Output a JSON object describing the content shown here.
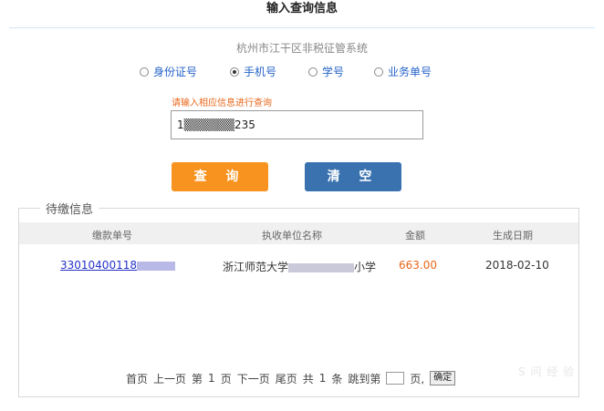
{
  "header": {
    "title": "输入查询信息"
  },
  "system_name": "杭州市江干区非税征管系统",
  "search_type": {
    "options": [
      {
        "label": "身份证号",
        "selected": false
      },
      {
        "label": "手机号",
        "selected": true
      },
      {
        "label": "学号",
        "selected": false
      },
      {
        "label": "业务单号",
        "selected": false
      }
    ]
  },
  "query": {
    "hint": "请输入相应信息进行查询",
    "value": "1▒▒▒▒▒▒235"
  },
  "buttons": {
    "query": "查 询",
    "clear": "清 空"
  },
  "results": {
    "legend": "待缴信息",
    "columns": [
      "缴款单号",
      "执收单位名称",
      "金额",
      "生成日期"
    ],
    "rows": [
      {
        "bill_no": "33010400118",
        "unit_prefix": "浙江师范大学",
        "unit_suffix": "小学",
        "amount": "663.00",
        "date": "2018-02-10"
      }
    ]
  },
  "pagination": {
    "first": "首页",
    "prev": "上一页",
    "page_prefix": "第",
    "current_page": "1",
    "page_suffix": "页",
    "next": "下一页",
    "last": "尾页",
    "total_prefix": "共",
    "total_count": "1",
    "total_suffix": "条",
    "jump_label": "跳到第",
    "jump_suffix": "页,",
    "confirm": "确定"
  },
  "watermark": "S 问 经 验",
  "colors": {
    "accent_orange": "#f7931e",
    "accent_blue": "#3a72b0",
    "link": "#2432c9"
  }
}
